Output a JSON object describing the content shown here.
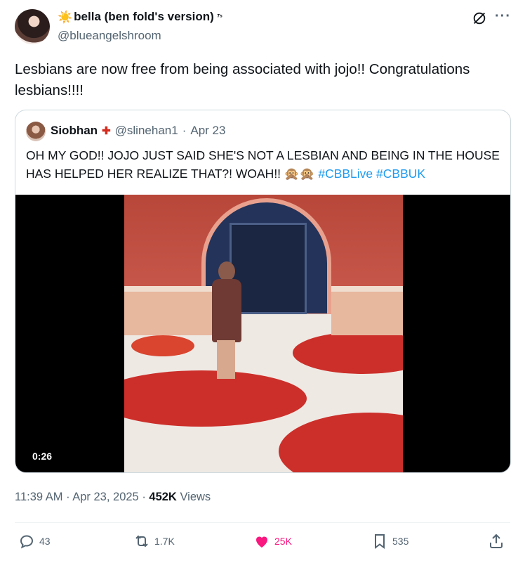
{
  "tweet": {
    "author": {
      "name_prefix": "☀️",
      "display_name": "bella (ben fold's version)",
      "name_suffix": "ᵀˢ",
      "handle": "@blueangelshroom"
    },
    "text": "Lesbians are now free from being associated with jojo!! Congratulations lesbians!!!!",
    "timestamp": "11:39 AM · Apr 23, 2025 · ",
    "views_count": "452K",
    "views_label": " Views"
  },
  "quote": {
    "name": "Siobhan",
    "flag": "✚",
    "handle": "@slinehan1",
    "date_sep": " · ",
    "date": "Apr 23",
    "text_main": "OH MY GOD!! JOJO JUST SAID SHE'S NOT A LESBIAN AND BEING IN THE HOUSE HAS HELPED HER REALIZE THAT?! WOAH!! 🙊🙊 ",
    "hashtags": "#CBBLive #CBBUK",
    "video_duration": "0:26"
  },
  "actions": {
    "replies": "43",
    "reposts": "1.7K",
    "likes": "25K",
    "bookmarks": "535"
  },
  "colors": {
    "text_primary": "#0f1419",
    "text_secondary": "#536471",
    "link": "#1d9bf0",
    "like": "#f91880",
    "border": "#cfd9de"
  },
  "icons": [
    "grok-icon",
    "more-icon",
    "reply-icon",
    "repost-icon",
    "like-icon",
    "bookmark-icon",
    "share-icon"
  ]
}
